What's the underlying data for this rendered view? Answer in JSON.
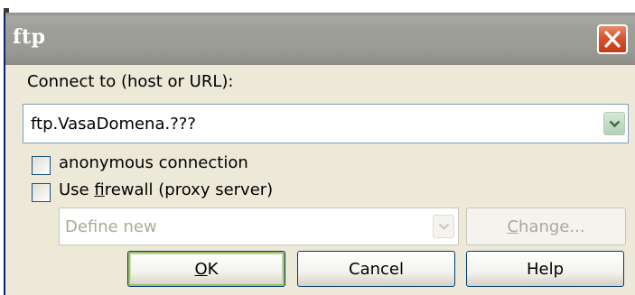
{
  "window": {
    "title": "ftp"
  },
  "form": {
    "connect_label": "Connect to (host or URL):",
    "host_value": "ftp.VasaDomena.???",
    "anonymous": {
      "label": "anonymous connection",
      "checked": false
    },
    "firewall": {
      "label_before": "Use ",
      "label_accel": "f",
      "label_after": "irewall (proxy server)",
      "checked": false
    },
    "proxy": {
      "selected": "Define new",
      "enabled": false
    },
    "change": {
      "accel": "C",
      "rest": "hange...",
      "enabled": false
    }
  },
  "buttons": {
    "ok_accel": "O",
    "ok_rest": "K",
    "cancel": "Cancel",
    "help": "Help"
  },
  "icons": {
    "close": "close-icon",
    "dropdown": "chevron-down-icon"
  },
  "colors": {
    "titlebar": "#9b9b96",
    "close_button": "#d8542f",
    "dialog_bg": "#ece9d8",
    "disabled_text": "#aca899",
    "default_button_ring": "#a2bd6b"
  }
}
